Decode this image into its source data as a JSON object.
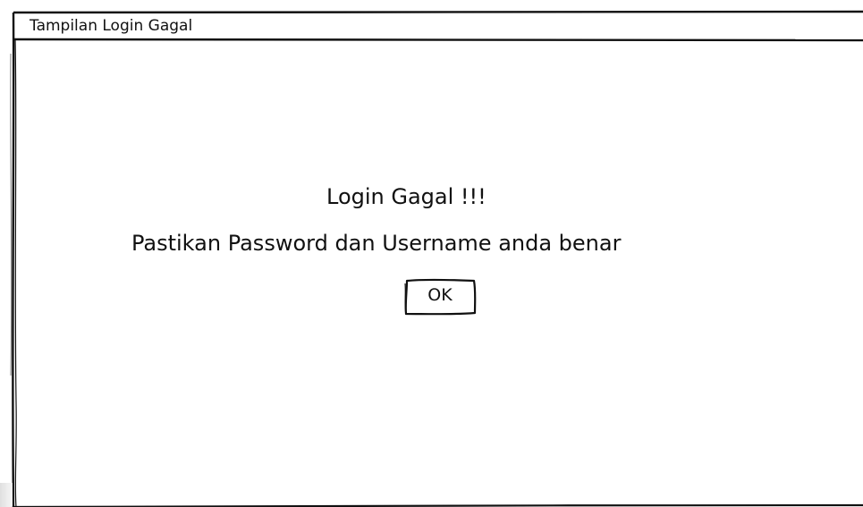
{
  "window": {
    "title": "Tampilan Login Gagal"
  },
  "dialog": {
    "headline": "Login Gagal !!!",
    "message": "Pastikan Password dan Username anda benar",
    "ok_label": "OK"
  }
}
